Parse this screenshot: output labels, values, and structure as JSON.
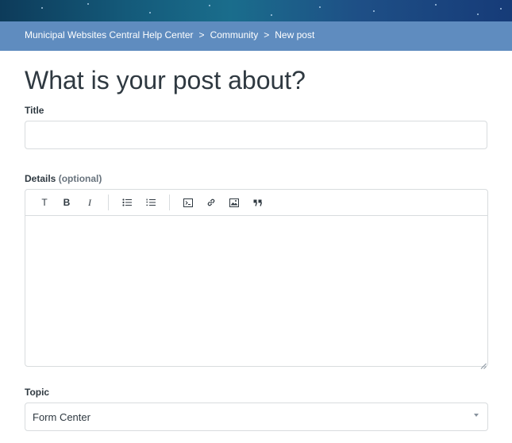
{
  "breadcrumb": {
    "items": [
      "Municipal Websites Central Help Center",
      "Community",
      "New post"
    ],
    "separator": ">"
  },
  "page": {
    "title": "What is your post about?"
  },
  "form": {
    "title_label": "Title",
    "title_value": "",
    "details_label": "Details",
    "details_optional": "(optional)",
    "details_value": "",
    "topic_label": "Topic",
    "topic_value": "Form Center"
  },
  "toolbar": {
    "text_style": "T",
    "bold": "B",
    "italic": "I",
    "icons": [
      "text-style-icon",
      "bold-icon",
      "italic-icon",
      "bulleted-list-icon",
      "numbered-list-icon",
      "code-block-icon",
      "link-icon",
      "image-icon",
      "quote-icon"
    ]
  },
  "colors": {
    "breadcrumb_bar": "#5f8cbf",
    "text": "#2f3941",
    "border": "#d8dcde"
  }
}
